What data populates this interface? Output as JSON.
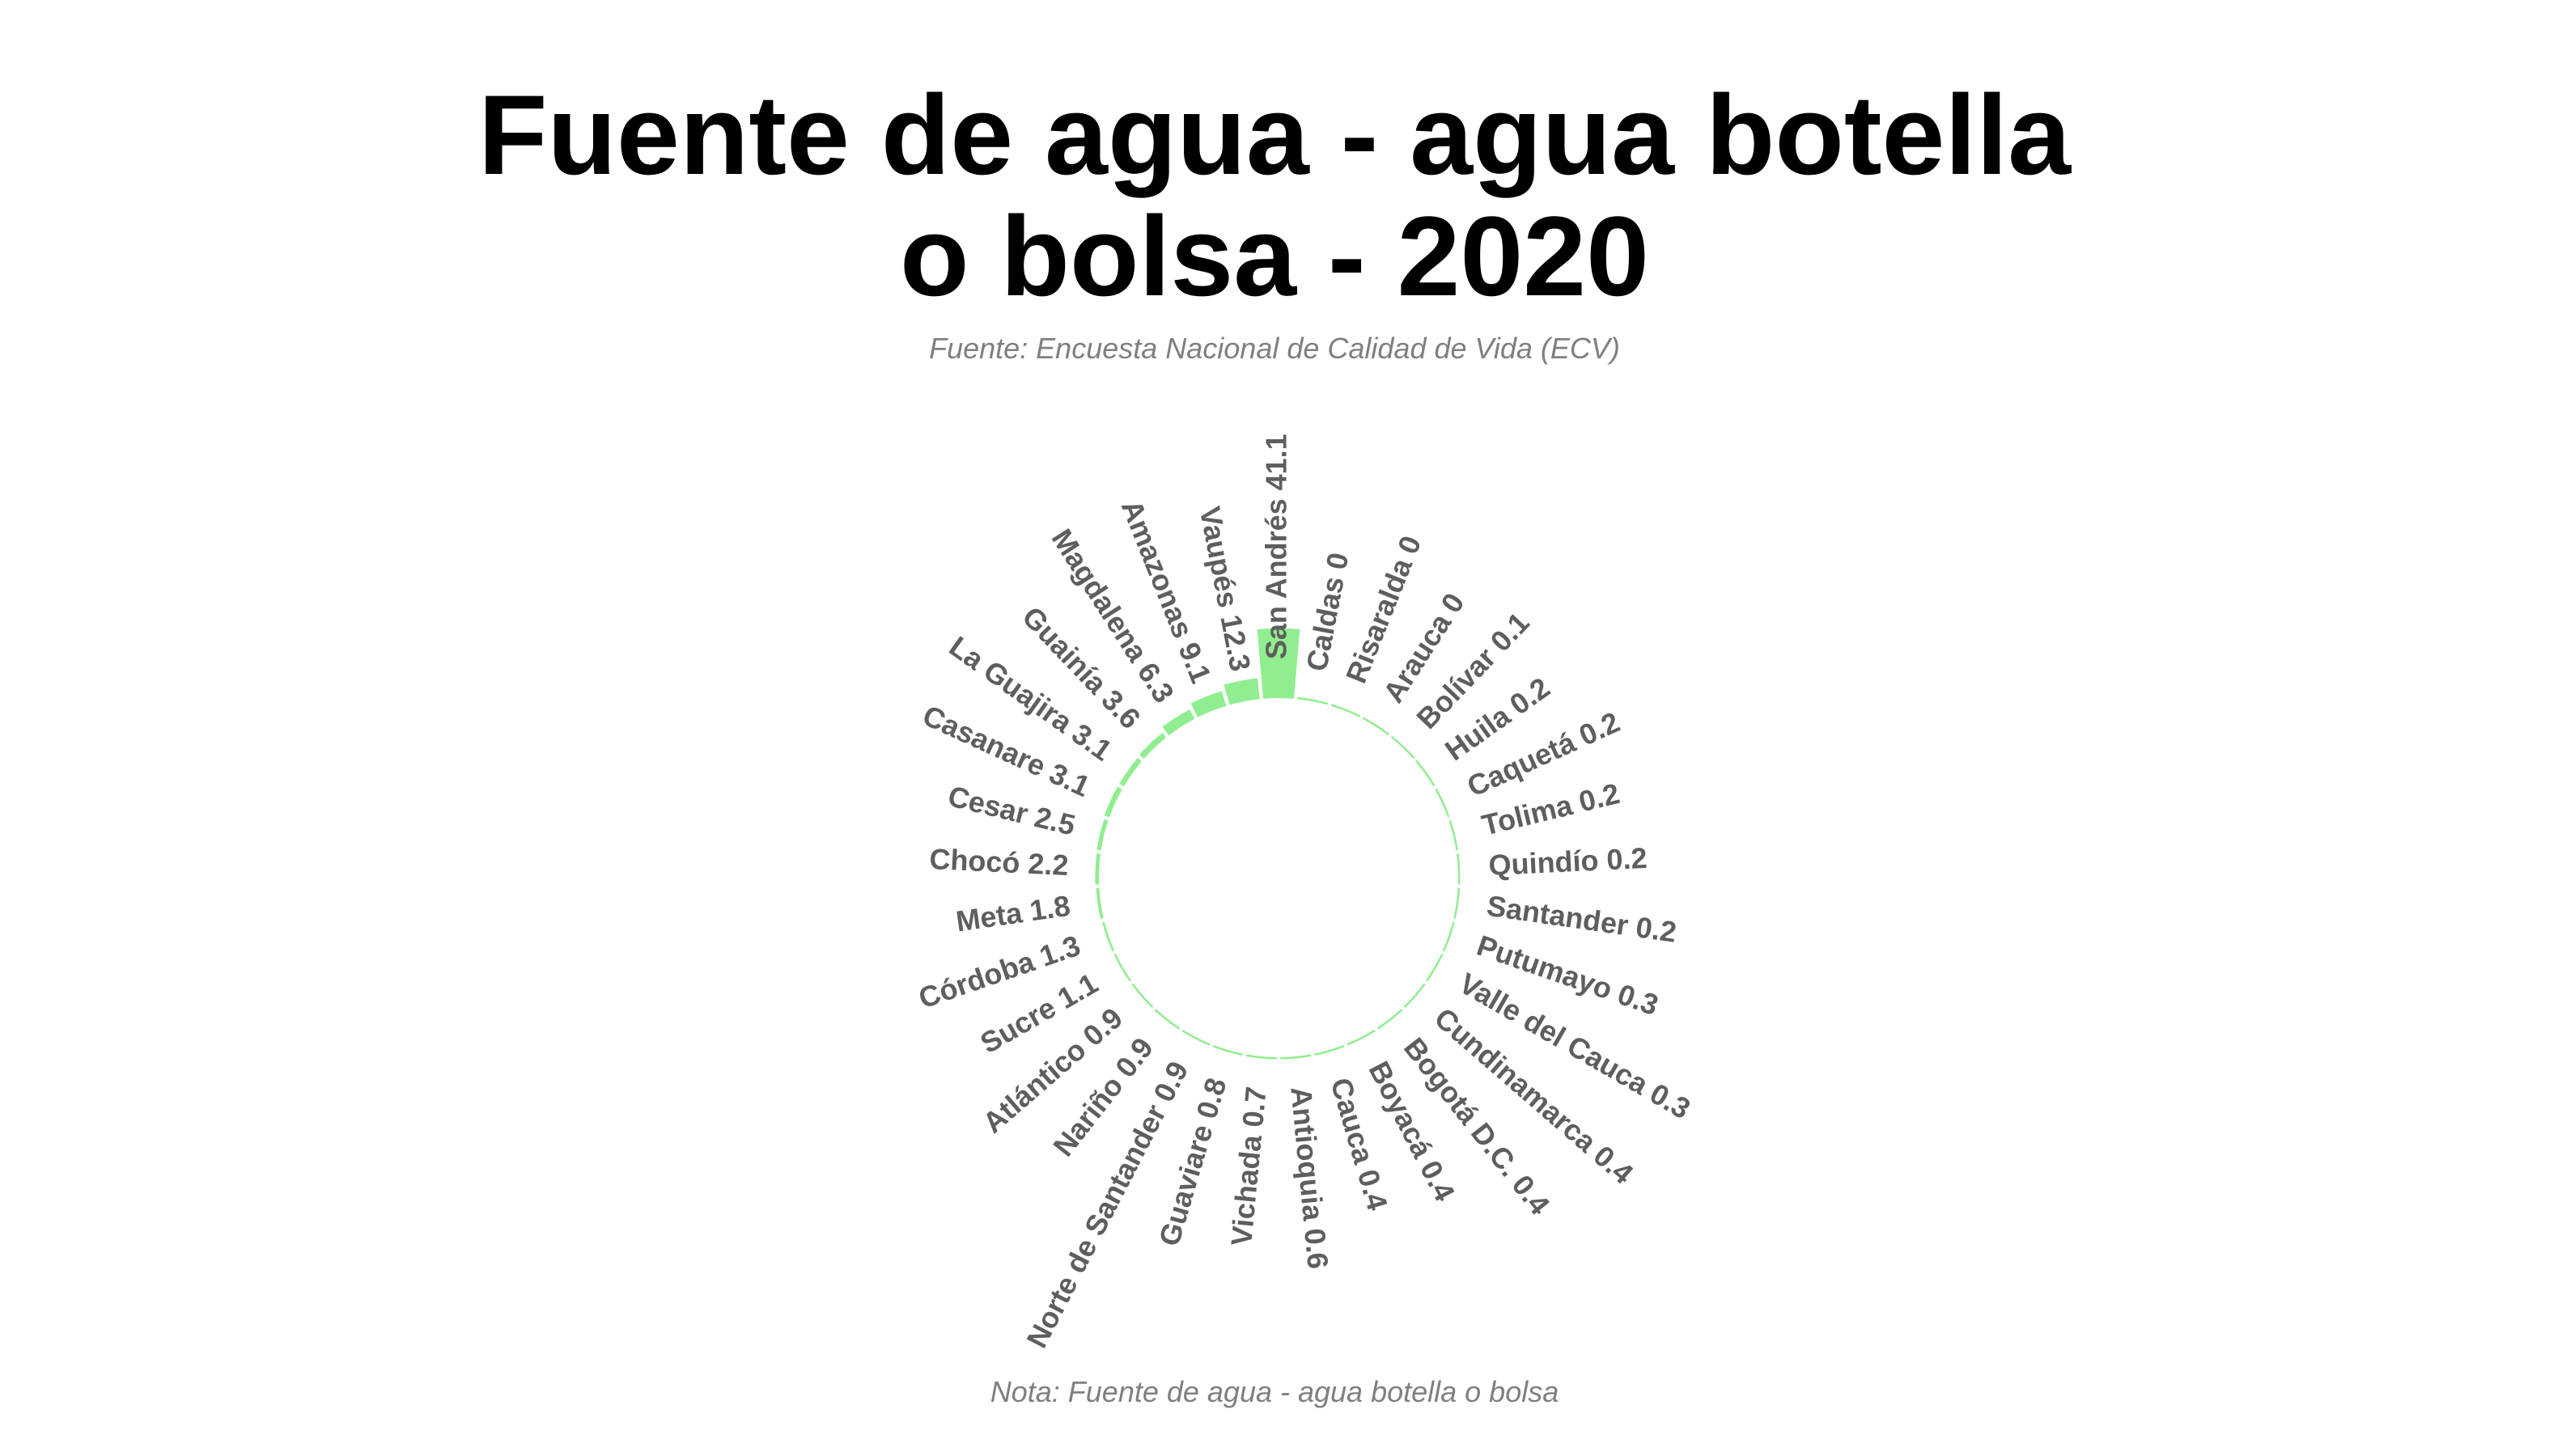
{
  "chart_data": {
    "type": "bar",
    "layout": "circular",
    "title": [
      "Fuente de agua - agua botella",
      "o bolsa - 2020"
    ],
    "subtitle": "Fuente: Encuesta Nacional de Calidad de Vida (ECV)",
    "caption": "Nota: Fuente de agua - agua botella o bolsa",
    "bar_color": "#90ee90",
    "label_color": "#5e5e5e",
    "categories": [
      "San Andrés",
      "Caldas",
      "Risaralda",
      "Arauca",
      "Bolívar",
      "Huila",
      "Caquetá",
      "Tolima",
      "Quindío",
      "Santander",
      "Putumayo",
      "Valle del Cauca",
      "Cundinamarca",
      "Bogotá D.C.",
      "Boyacá",
      "Cauca",
      "Antioquia",
      "Vichada",
      "Guaviare",
      "Norte de Santander",
      "Nariño",
      "Atlántico",
      "Sucre",
      "Córdoba",
      "Meta",
      "Chocó",
      "Cesar",
      "Casanare",
      "La Guajira",
      "Guainía",
      "Magdalena",
      "Amazonas",
      "Vaupés"
    ],
    "values": [
      41.1,
      0,
      0,
      0,
      0.1,
      0.2,
      0.2,
      0.2,
      0.2,
      0.2,
      0.3,
      0.3,
      0.4,
      0.4,
      0.4,
      0.4,
      0.6,
      0.7,
      0.8,
      0.9,
      0.9,
      0.9,
      1.1,
      1.3,
      1.8,
      2.2,
      2.5,
      3.1,
      3.1,
      3.6,
      6.3,
      9.1,
      12.3
    ],
    "value_labels": [
      "41.1",
      "0",
      "0",
      "0",
      "0.1",
      "0.2",
      "0.2",
      "0.2",
      "0.2",
      "0.2",
      "0.3",
      "0.3",
      "0.4",
      "0.4",
      "0.4",
      "0.4",
      "0.6",
      "0.7",
      "0.8",
      "0.9",
      "0.9",
      "0.9",
      "1.1",
      "1.3",
      "1.8",
      "2.2",
      "2.5",
      "3.1",
      "3.1",
      "3.6",
      "6.3",
      "9.1",
      "12.3"
    ]
  }
}
